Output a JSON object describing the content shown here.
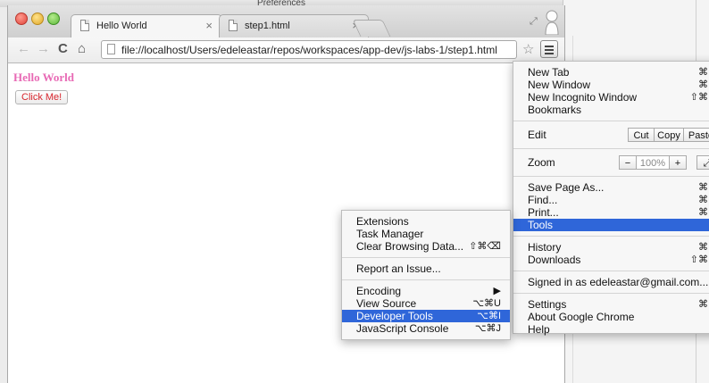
{
  "background_window": {
    "title": "Preferences"
  },
  "tabs": [
    {
      "title": "Hello World",
      "close": "×",
      "active": true
    },
    {
      "title": "step1.html",
      "close": "×",
      "active": false
    }
  ],
  "toolbar": {
    "back": "←",
    "forward": "→",
    "reload": "C",
    "home": "⌂",
    "url": "file://localhost/Users/edeleastar/repos/workspaces/app-dev/js-labs-1/step1.html",
    "star": "☆"
  },
  "page": {
    "heading": "Hello World",
    "button_label": "Click Me!"
  },
  "main_menu": {
    "group1": [
      {
        "label": "New Tab",
        "shortcut": "⌘"
      },
      {
        "label": "New Window",
        "shortcut": "⌘"
      },
      {
        "label": "New Incognito Window",
        "shortcut": "⇧⌘"
      },
      {
        "label": "Bookmarks",
        "shortcut": ""
      }
    ],
    "edit": {
      "label": "Edit",
      "cut": "Cut",
      "copy": "Copy",
      "paste": "Paste"
    },
    "zoom": {
      "label": "Zoom",
      "minus": "−",
      "level": "100%",
      "plus": "+",
      "fullscreen": "⤢"
    },
    "group3": [
      {
        "label": "Save Page As...",
        "shortcut": "⌘"
      },
      {
        "label": "Find...",
        "shortcut": "⌘"
      },
      {
        "label": "Print...",
        "shortcut": "⌘"
      },
      {
        "label": "Tools",
        "shortcut": ""
      }
    ],
    "group4": [
      {
        "label": "History",
        "shortcut": "⌘"
      },
      {
        "label": "Downloads",
        "shortcut": "⇧⌘"
      }
    ],
    "signed_in": "Signed in as edeleastar@gmail.com...",
    "group6": [
      {
        "label": "Settings",
        "shortcut": "⌘"
      },
      {
        "label": "About Google Chrome",
        "shortcut": ""
      },
      {
        "label": "Help",
        "shortcut": ""
      }
    ]
  },
  "tools_menu": {
    "group1": [
      {
        "label": "Extensions",
        "shortcut": ""
      },
      {
        "label": "Task Manager",
        "shortcut": ""
      },
      {
        "label": "Clear Browsing Data...",
        "shortcut": "⇧⌘⌫"
      }
    ],
    "report": "Report an Issue...",
    "group3": [
      {
        "label": "Encoding",
        "shortcut": "▶"
      },
      {
        "label": "View Source",
        "shortcut": "⌥⌘U"
      },
      {
        "label": "Developer Tools",
        "shortcut": "⌥⌘I"
      },
      {
        "label": "JavaScript Console",
        "shortcut": "⌥⌘J"
      }
    ]
  },
  "colors": {
    "highlight": "#2f66d9",
    "heading": "#e86ab5",
    "button_text": "#d8262e"
  }
}
